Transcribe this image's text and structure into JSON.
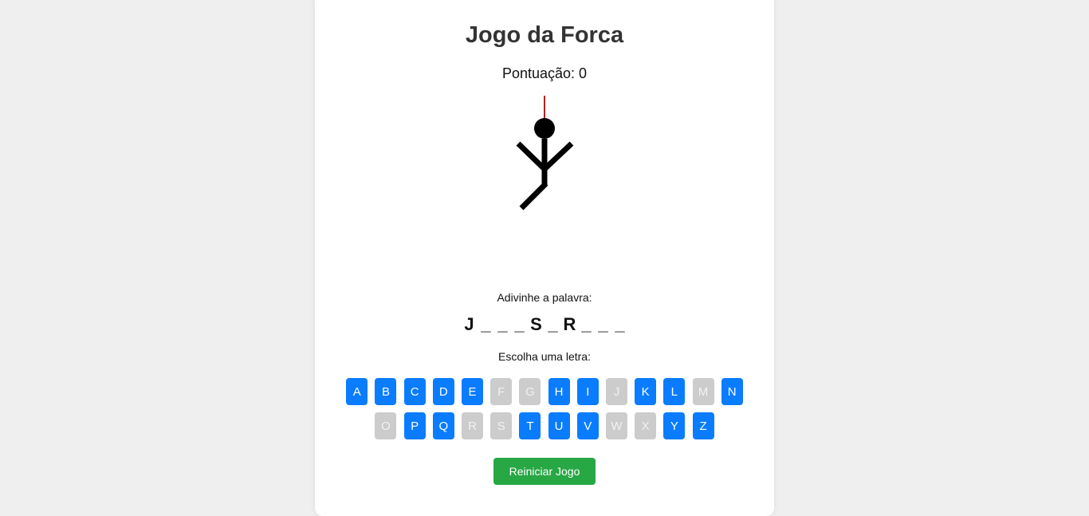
{
  "game": {
    "title": "Jogo da Forca",
    "score_label": "Pontuação:",
    "score_value": "0",
    "guess_prompt": "Adivinhe a palavra:",
    "word_display": [
      "J",
      "_",
      "_",
      "_",
      "S",
      "_",
      "R",
      "_",
      "_",
      "_"
    ],
    "letter_prompt": "Escolha uma letra:",
    "restart_label": "Reiniciar Jogo"
  },
  "keyboard": {
    "rows": [
      [
        {
          "letter": "A",
          "used": false
        },
        {
          "letter": "B",
          "used": false
        },
        {
          "letter": "C",
          "used": false
        },
        {
          "letter": "D",
          "used": false
        },
        {
          "letter": "E",
          "used": false
        },
        {
          "letter": "F",
          "used": true
        },
        {
          "letter": "G",
          "used": true
        },
        {
          "letter": "H",
          "used": false
        },
        {
          "letter": "I",
          "used": false
        },
        {
          "letter": "J",
          "used": true
        },
        {
          "letter": "K",
          "used": false
        },
        {
          "letter": "L",
          "used": false
        },
        {
          "letter": "M",
          "used": true
        },
        {
          "letter": "N",
          "used": false
        }
      ],
      [
        {
          "letter": "O",
          "used": true
        },
        {
          "letter": "P",
          "used": false
        },
        {
          "letter": "Q",
          "used": false
        },
        {
          "letter": "R",
          "used": true
        },
        {
          "letter": "S",
          "used": true
        },
        {
          "letter": "T",
          "used": false
        },
        {
          "letter": "U",
          "used": false
        },
        {
          "letter": "V",
          "used": false
        },
        {
          "letter": "W",
          "used": true
        },
        {
          "letter": "X",
          "used": true
        },
        {
          "letter": "Y",
          "used": false
        },
        {
          "letter": "Z",
          "used": false
        }
      ]
    ]
  },
  "hangman": {
    "parts_shown": [
      "rope",
      "head",
      "body",
      "left-arm",
      "right-arm",
      "left-leg"
    ],
    "rope_color": "#b22222",
    "figure_color": "#000000"
  },
  "colors": {
    "page_background": "#efefef",
    "card_background": "#ffffff",
    "key_active": "#0a7cff",
    "key_used": "#cccccc",
    "restart_button": "#28a745"
  }
}
